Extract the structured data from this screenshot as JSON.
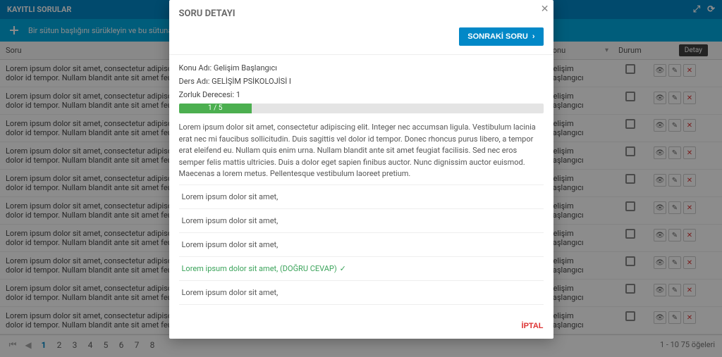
{
  "panel": {
    "title": "KAYITLI SORULAR",
    "groupHint": "Bir sütun başlığını sürükleyin ve bu sütuna göre gruplandır"
  },
  "columns": {
    "soru": "Soru",
    "konu": "Konu",
    "durum": "Durum"
  },
  "detayLabel": "Detay",
  "rows": [
    {
      "soru": "Lorem ipsum dolor sit amet, consectetur adipiscing elit. Integer nec accumsan ligula. Vestibulum lacinia erat nec mi faucibus sollicitudin. Duis sagittis vel dolor id tempor. Nullam blandit ante sit amet feugiat facilisis. Sed nec eros semper felis mattis ultricies.",
      "konu": "Gelişim Başlangıcı"
    },
    {
      "soru": "Lorem ipsum dolor sit amet, consectetur adipiscing elit. Integer nec accumsan ligula. Vestibulum lacinia erat nec mi faucibus sollicitudin. Duis sagittis vel dolor id tempor. Nullam blandit ante sit amet feugiat facilisis. Sed nec eros semper felis mattis ultricies.",
      "konu": "Gelişim Başlangıcı"
    },
    {
      "soru": "Lorem ipsum dolor sit amet, consectetur adipiscing elit. Integer nec accumsan ligula. Vestibulum lacinia erat nec mi faucibus sollicitudin. Duis sagittis vel dolor id tempor. Nullam blandit ante sit amet feugiat facilisis. Sed nec eros semper felis mattis ultricies.",
      "konu": "Gelişim Başlangıcı"
    },
    {
      "soru": "Lorem ipsum dolor sit amet, consectetur adipiscing elit. Integer nec accumsan ligula. Vestibulum lacinia erat nec mi faucibus sollicitudin. Duis sagittis vel dolor id tempor. Nullam blandit ante sit amet feugiat facilisis. Sed nec eros semper felis mattis ultricies.",
      "konu": "Gelişim Başlangıcı"
    },
    {
      "soru": "Lorem ipsum dolor sit amet, consectetur adipiscing elit. Integer nec accumsan ligula. Vestibulum lacinia erat nec mi faucibus sollicitudin. Duis sagittis vel dolor id tempor. Nullam blandit ante sit amet feugiat facilisis. Sed nec eros semper felis mattis ultricies.",
      "konu": "Gelişim Başlangıcı"
    },
    {
      "soru": "Lorem ipsum dolor sit amet, consectetur adipiscing elit. Integer nec accumsan ligula. Vestibulum lacinia erat nec mi faucibus sollicitudin. Duis sagittis vel dolor id tempor. Nullam blandit ante sit amet feugiat facilisis. Sed nec eros semper felis mattis ultricies.",
      "konu": "Gelişim Başlangıcı"
    },
    {
      "soru": "Lorem ipsum dolor sit amet, consectetur adipiscing elit. Integer nec accumsan ligula. Vestibulum lacinia erat nec mi faucibus sollicitudin. Duis sagittis vel dolor id tempor. Nullam blandit ante sit amet feugiat facilisis. Sed nec eros semper felis mattis ultricies.",
      "konu": "Gelişim Başlangıcı"
    },
    {
      "soru": "Lorem ipsum dolor sit amet, consectetur adipiscing elit. Integer nec accumsan ligula. Vestibulum lacinia erat nec mi faucibus sollicitudin. Duis sagittis vel dolor id tempor. Nullam blandit ante sit amet feugiat facilisis. Sed nec eros semper felis mattis ultricies.",
      "konu": "Gelişim Başlangıcı"
    },
    {
      "soru": "Lorem ipsum dolor sit amet, consectetur adipiscing elit. Integer nec accumsan ligula. Vestibulum lacinia erat nec mi faucibus sollicitudin. Duis sagittis vel dolor id tempor. Nullam blandit ante sit amet feugiat facilisis. Sed nec eros semper felis mattis ultricies.",
      "konu": "Gelişim Başlangıcı"
    },
    {
      "soru": "Lorem ipsum dolor sit amet, consectetur adipiscing elit. Integer nec accumsan ligula. Vestibulum lacinia erat nec mi faucibus sollicitudin. Duis sagittis vel dolor id tempor. Nullam blandit ante sit amet feugiat facilisis. Sed nec eros semper felis mattis ultricies.",
      "konu": "Gelişim Başlangıcı"
    }
  ],
  "pager": {
    "pages": [
      "1",
      "2",
      "3",
      "4",
      "5",
      "6",
      "7",
      "8"
    ],
    "current": "1",
    "info": "1 - 10 75 öğeleri"
  },
  "modal": {
    "title": "SORU DETAYI",
    "nextLabel": "SONRAKİ SORU",
    "cancelLabel": "İPTAL",
    "meta": {
      "konu": "Konu Adı: Gelişim Başlangıcı",
      "ders": "Ders Adı: GELİŞİM PSİKOLOJİSİ I",
      "zorluk": "Zorluk Derecesi: 1"
    },
    "progress": {
      "label": "1 / 5",
      "percent": 20
    },
    "questionText": "Lorem ipsum dolor sit amet, consectetur adipiscing elit. Integer nec accumsan ligula. Vestibulum lacinia erat nec mi faucibus sollicitudin. Duis sagittis vel dolor id tempor. Donec rhoncus purus libero, a tempor erat eleifend eu. Nullam quis enim urna. Nullam blandit ante sit amet feugiat facilisis. Sed nec eros semper felis mattis ultricies. Duis a dolor eget sapien finibus auctor. Nunc dignissim auctor euismod. Maecenas a lorem metus. Pellentesque vestibulum laoreet pretium.",
    "options": [
      {
        "text": "Lorem ipsum dolor sit amet,",
        "correct": false
      },
      {
        "text": "Lorem ipsum dolor sit amet,",
        "correct": false
      },
      {
        "text": "Lorem ipsum dolor sit amet,",
        "correct": false
      },
      {
        "text": "Lorem ipsum dolor sit amet, (DOĞRU CEVAP)",
        "correct": true
      },
      {
        "text": "Lorem ipsum dolor sit amet,",
        "correct": false
      }
    ]
  }
}
